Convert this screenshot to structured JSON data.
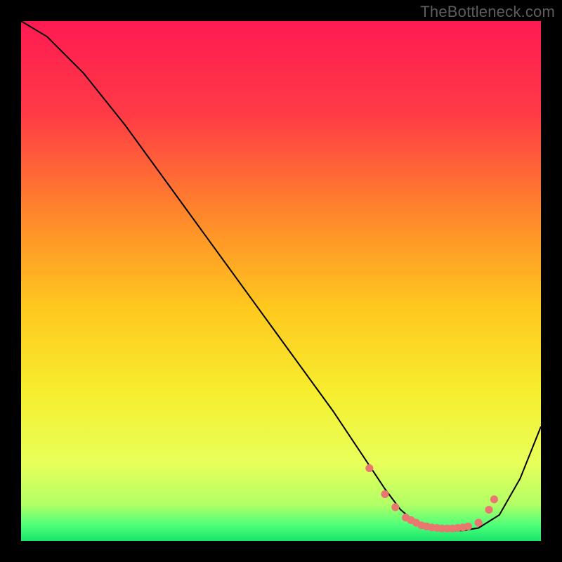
{
  "watermark": "TheBottleneck.com",
  "colors": {
    "curve": "#000000",
    "marker": "#e9766f",
    "gradient_stops": [
      {
        "pct": 0,
        "color": "#ff1a52"
      },
      {
        "pct": 18,
        "color": "#ff3b46"
      },
      {
        "pct": 38,
        "color": "#ff8a2a"
      },
      {
        "pct": 55,
        "color": "#ffc81e"
      },
      {
        "pct": 72,
        "color": "#f6ef2f"
      },
      {
        "pct": 85,
        "color": "#e8ff5a"
      },
      {
        "pct": 93,
        "color": "#b2ff66"
      },
      {
        "pct": 97,
        "color": "#4dff7a"
      },
      {
        "pct": 100,
        "color": "#18e46a"
      }
    ]
  },
  "chart_data": {
    "type": "line",
    "title": "",
    "xlabel": "",
    "ylabel": "",
    "xlim": [
      0,
      100
    ],
    "ylim": [
      0,
      100
    ],
    "series": [
      {
        "name": "bottleneck-curve",
        "x": [
          0,
          5,
          12,
          20,
          28,
          36,
          44,
          52,
          60,
          66,
          70,
          73,
          76,
          79,
          82,
          85,
          88,
          92,
          96,
          100
        ],
        "y": [
          100,
          97,
          90,
          80,
          69,
          58,
          47,
          36,
          25,
          16,
          10,
          6,
          3.5,
          2.5,
          2,
          2,
          2.5,
          5,
          12,
          22
        ]
      }
    ],
    "markers": {
      "series": "bottleneck-curve",
      "note": "salmon dots along the trough region",
      "x": [
        67,
        70,
        72,
        74,
        75,
        76,
        77,
        78,
        79,
        80,
        81,
        82,
        83,
        84,
        85,
        86,
        88,
        90,
        91
      ],
      "y": [
        14,
        9,
        6.5,
        4.5,
        4,
        3.5,
        3,
        2.8,
        2.6,
        2.5,
        2.4,
        2.4,
        2.4,
        2.5,
        2.6,
        2.8,
        3.5,
        6,
        8
      ]
    }
  }
}
